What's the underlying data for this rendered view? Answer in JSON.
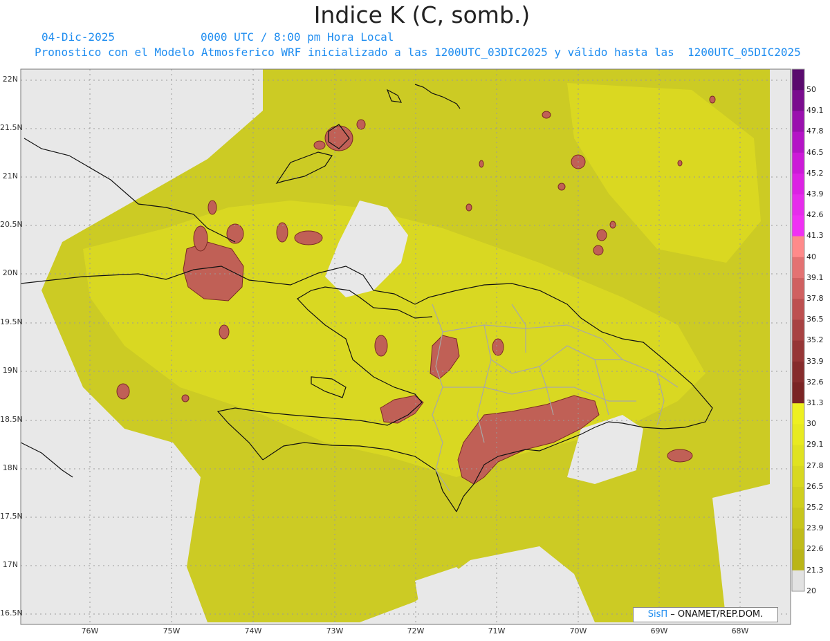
{
  "header": {
    "title": "Indice K (C, somb.)",
    "date": "04-Dic-2025",
    "time": "0000 UTC / 8:00 pm Hora Local",
    "model": "Pronostico con el Modelo Atmosferico WRF inicializado a las 1200UTC_03DIC2025 y válido hasta las  1200UTC_05DIC2025"
  },
  "axes": {
    "lat_labels": [
      "22N",
      "21.5N",
      "21N",
      "20.5N",
      "20N",
      "19.5N",
      "19N",
      "18.5N",
      "18N",
      "17.5N",
      "17N",
      "16.5N"
    ],
    "lon_labels": [
      "76W",
      "75W",
      "74W",
      "73W",
      "72W",
      "71W",
      "70W",
      "69W",
      "68W"
    ]
  },
  "colorbar": {
    "labels": [
      "50",
      "49.1",
      "47.8",
      "46.5",
      "45.2",
      "43.9",
      "42.6",
      "41.3",
      "40",
      "39.1",
      "37.8",
      "36.5",
      "35.2",
      "33.9",
      "32.6",
      "31.3",
      "30",
      "29.1",
      "27.8",
      "26.5",
      "25.2",
      "23.9",
      "22.6",
      "21.3",
      "20"
    ],
    "colors": [
      "#5a0a6e",
      "#7a0c8e",
      "#9a10ae",
      "#b414c6",
      "#cc1ad8",
      "#dc22e4",
      "#e62cec",
      "#f030f4",
      "#ff8a8a",
      "#e47272",
      "#d06060",
      "#bd5050",
      "#a84242",
      "#963636",
      "#862c2c",
      "#7a2424",
      "#eef020",
      "#e8ea20",
      "#e0e220",
      "#d8d820",
      "#d0cf1e",
      "#c8c61c",
      "#c0bc1a",
      "#bab518",
      "#e2e2e2"
    ]
  },
  "credit": {
    "brand": "SisΠ",
    "text": " – ONAMET/REP.DOM."
  }
}
